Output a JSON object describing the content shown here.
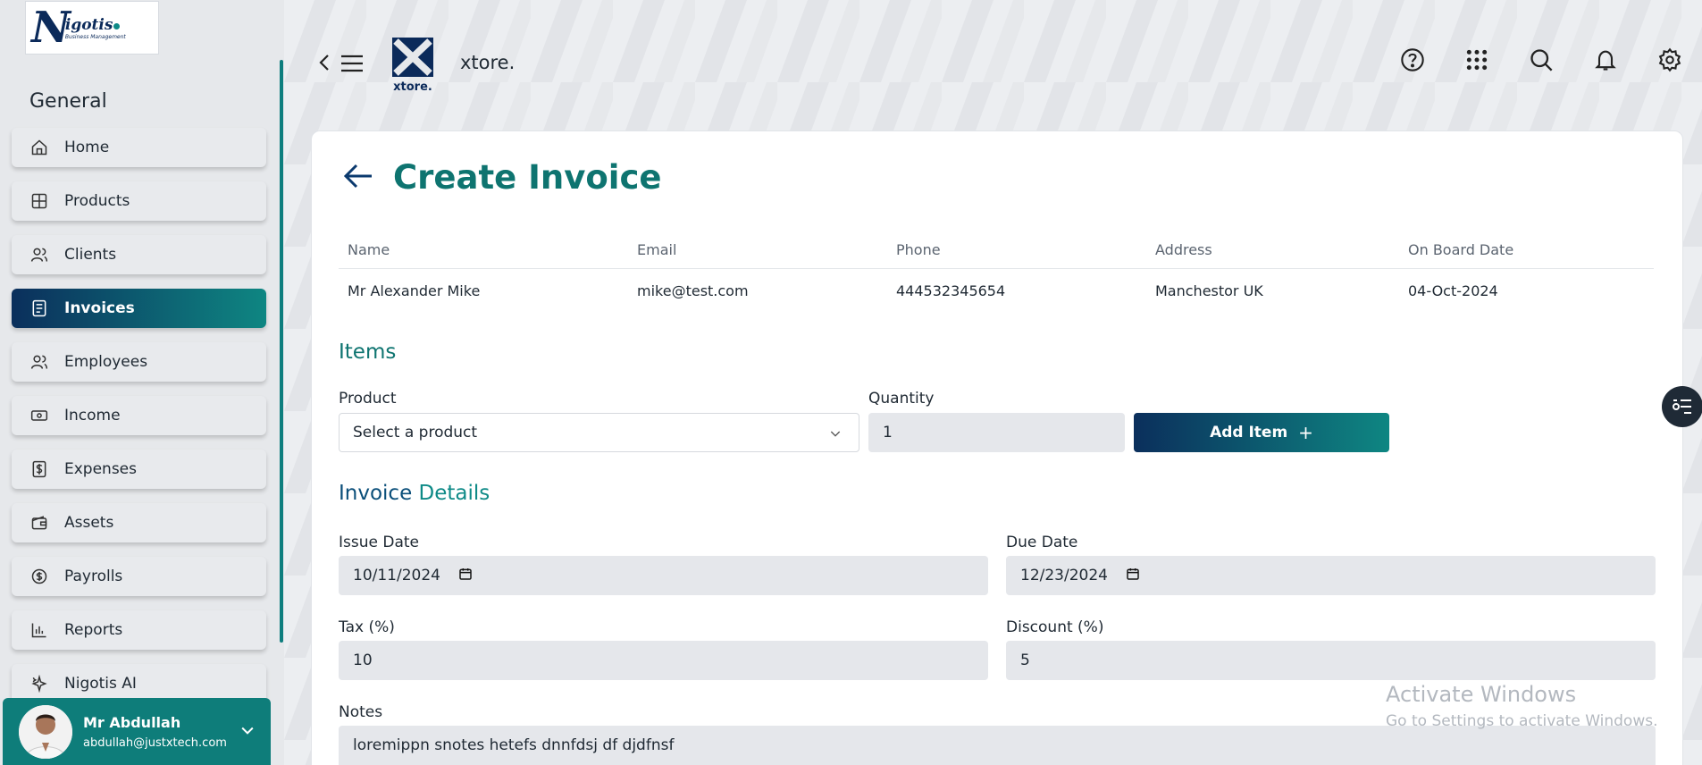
{
  "sidebar": {
    "logo": {
      "mark": "N",
      "name": "igotis",
      "tagline": "Business Management"
    },
    "section_title": "General",
    "items": [
      {
        "label": "Home",
        "icon": "home-icon"
      },
      {
        "label": "Products",
        "icon": "grid-icon"
      },
      {
        "label": "Clients",
        "icon": "users-icon"
      },
      {
        "label": "Invoices",
        "icon": "document-icon",
        "active": true
      },
      {
        "label": "Employees",
        "icon": "users-icon"
      },
      {
        "label": "Income",
        "icon": "cash-icon"
      },
      {
        "label": "Expenses",
        "icon": "dollar-file-icon"
      },
      {
        "label": "Assets",
        "icon": "wallet-icon"
      },
      {
        "label": "Payrolls",
        "icon": "coin-icon"
      },
      {
        "label": "Reports",
        "icon": "bar-chart-icon"
      },
      {
        "label": "Nigotis AI",
        "icon": "sparkle-icon"
      }
    ],
    "user": {
      "name": "Mr Abdullah",
      "email": "abdullah@justxtech.com"
    }
  },
  "topbar": {
    "store_logo_text": "xtore.",
    "store_name": "xtore.",
    "icons": [
      "help-icon",
      "apps-icon",
      "search-icon",
      "bell-icon",
      "gear-icon"
    ]
  },
  "page": {
    "title": "Create Invoice"
  },
  "client_table": {
    "headers": [
      "Name",
      "Email",
      "Phone",
      "Address",
      "On Board Date"
    ],
    "row": [
      "Mr Alexander Mike",
      "mike@test.com",
      "444532345654",
      "Manchestor UK",
      "04-Oct-2024"
    ]
  },
  "items": {
    "title": "Items",
    "product_label": "Product",
    "product_placeholder": "Select a product",
    "quantity_label": "Quantity",
    "quantity_value": "1",
    "add_button": "Add Item",
    "add_button_icon": "+"
  },
  "details": {
    "title_part1": "Invoice",
    "title_part2": "Details",
    "issue_date_label": "Issue Date",
    "issue_date": "10/11/2024",
    "due_date_label": "Due Date",
    "due_date": "12/23/2024",
    "tax_label": "Tax (%)",
    "tax": "10",
    "discount_label": "Discount (%)",
    "discount": "5",
    "notes_label": "Notes",
    "notes": "loremippn snotes hetefs dnnfdsj df djdfnsf"
  },
  "watermark": {
    "line1": "Activate Windows",
    "line2": "Go to Settings to activate Windows."
  },
  "colors": {
    "accent": "#0e7d7a",
    "navy": "#0b2f5c"
  }
}
